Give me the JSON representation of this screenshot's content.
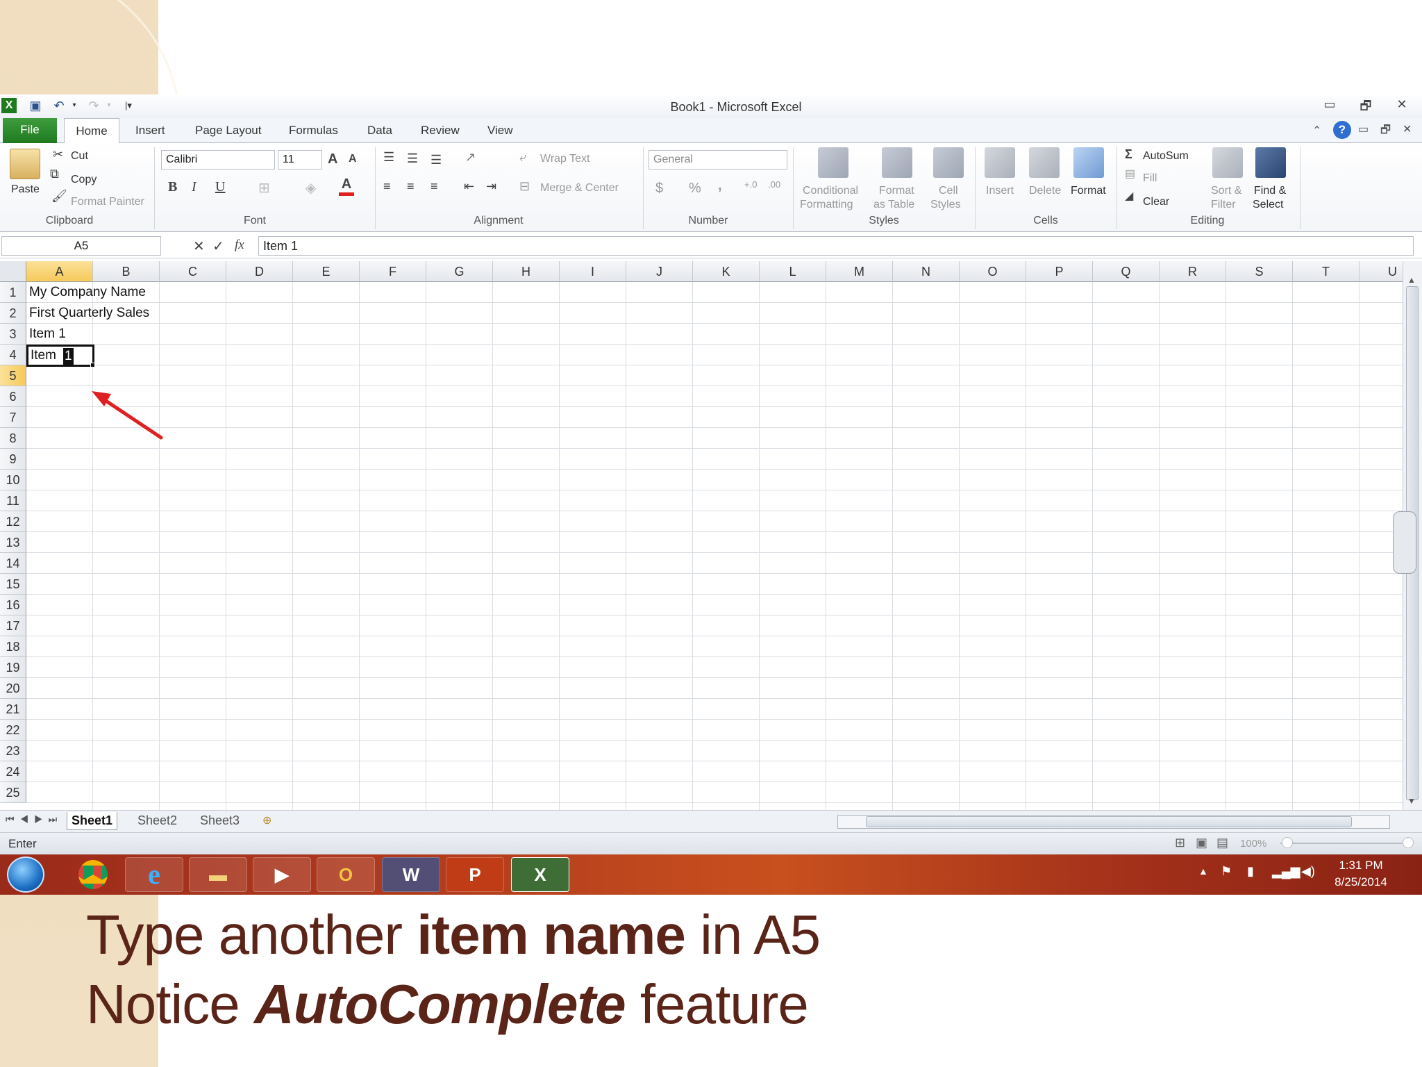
{
  "window": {
    "title": "Book1 - Microsoft Excel",
    "min_label": "▭",
    "restore_label": "🗗",
    "close_label": "✕"
  },
  "tabs": [
    "File",
    "Home",
    "Insert",
    "Page Layout",
    "Formulas",
    "Data",
    "Review",
    "View"
  ],
  "ribbon": {
    "clipboard": {
      "paste": "Paste",
      "cut": "Cut",
      "copy": "Copy",
      "format_painter": "Format Painter",
      "label": "Clipboard"
    },
    "font": {
      "name": "Calibri",
      "size": "11",
      "bold": "B",
      "italic": "I",
      "underline": "U",
      "grow": "A",
      "shrink": "A",
      "font_color": "A",
      "label": "Font"
    },
    "alignment": {
      "wrap": "Wrap Text",
      "merge": "Merge & Center",
      "label": "Alignment"
    },
    "number": {
      "format": "General",
      "currency": "$",
      "percent": "%",
      "comma": ",",
      "inc_decimal": "+.0\n.00",
      "dec_decimal": ".00\n→.0",
      "label": "Number"
    },
    "styles": {
      "conditional": "Conditional",
      "conditional2": "Formatting",
      "format_table": "Format",
      "format_table2": "as Table",
      "cell_styles": "Cell",
      "cell_styles2": "Styles",
      "label": "Styles"
    },
    "cells": {
      "insert": "Insert",
      "delete": "Delete",
      "format": "Format",
      "label": "Cells"
    },
    "editing": {
      "autosum": "AutoSum",
      "fill": "Fill",
      "clear": "Clear",
      "sort": "Sort &",
      "sort2": "Filter",
      "find": "Find &",
      "find2": "Select",
      "label": "Editing"
    }
  },
  "formula_bar": {
    "name_box": "A5",
    "content": "Item 1",
    "fx": "fx"
  },
  "columns": [
    "A",
    "B",
    "C",
    "D",
    "E",
    "F",
    "G",
    "H",
    "I",
    "J",
    "K",
    "L",
    "M",
    "N",
    "O",
    "P",
    "Q",
    "R",
    "S",
    "T",
    "U"
  ],
  "rows": [
    "1",
    "2",
    "3",
    "4",
    "5",
    "6",
    "7",
    "8",
    "9",
    "10",
    "11",
    "12",
    "13",
    "14",
    "15",
    "16",
    "17",
    "18",
    "19",
    "20",
    "21",
    "22",
    "23",
    "24",
    "25"
  ],
  "cells": {
    "a1": "My Company Name",
    "a2": "First Quarterly Sales",
    "a4": "Item 1",
    "a5_typed": "Item ",
    "a5_autocomplete": "1"
  },
  "sheets": [
    "Sheet1",
    "Sheet2",
    "Sheet3"
  ],
  "status": {
    "mode": "Enter",
    "zoom": "100%"
  },
  "clock": {
    "time": "1:31 PM",
    "date": "8/25/2014"
  },
  "taskbar_apps": [
    "start",
    "chrome",
    "ie",
    "explorer",
    "media",
    "outlook",
    "word",
    "powerpoint",
    "excel"
  ],
  "caption": {
    "line1_a": "Type another ",
    "line1_b": "item name",
    "line1_c": " in A5",
    "line2_a": "Notice ",
    "line2_b": "AutoComplete",
    "line2_c": " feature"
  },
  "colors": {
    "arrow": "#e02020",
    "file_tab": "#2a8a2a",
    "caption": "#5a2418"
  }
}
